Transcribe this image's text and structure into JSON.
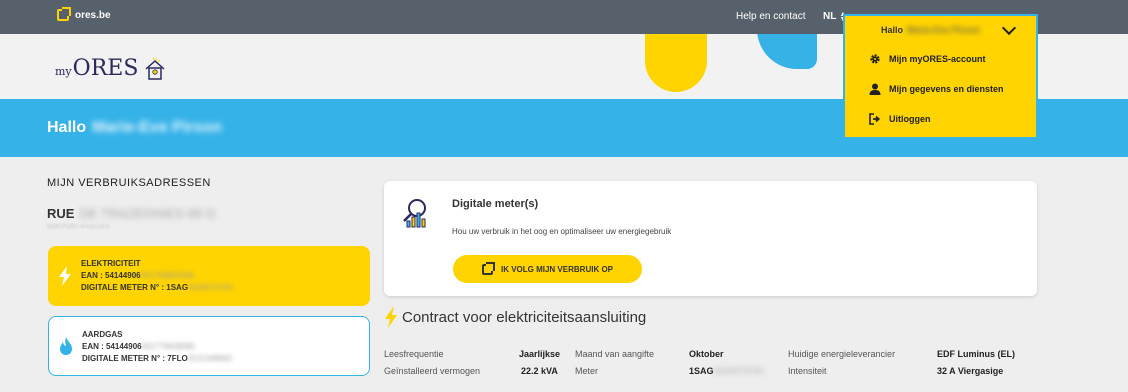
{
  "topbar": {
    "ores_link": "ores.be",
    "help": "Help en contact",
    "lang": "NL"
  },
  "account_menu": {
    "greeting": "Hallo",
    "user_name": "Marie-Eve Pirson",
    "items": [
      {
        "label": "Mijn myORES-account",
        "icon": "gear-icon"
      },
      {
        "label": "Mijn gegevens en diensten",
        "icon": "user-icon"
      },
      {
        "label": "Uitloggen",
        "icon": "logout-icon"
      }
    ]
  },
  "logo": {
    "my": "my",
    "ores": "ORES"
  },
  "hello_band": {
    "greeting": "Hallo",
    "user_name": "Marie-Eve Pirson"
  },
  "addresses": {
    "section_title": "MIJN VERBRUIKSADRESSEN",
    "street_prefix": "RUE",
    "street_hidden": "DE TRAZEGNIES 69 G",
    "city_hidden": "6230 PONT-A-CELLES",
    "meters": [
      {
        "type": "ELEKTRICITEIT",
        "ean_label": "EAN : 54144906",
        "ean_hidden": "001750820284",
        "meter_label": "DIGITALE METER N° : 1SAG",
        "meter_hidden": "3100074792",
        "icon": "bolt-icon"
      },
      {
        "type": "AARDGAS",
        "ean_label": "EAN : 54144906",
        "ean_hidden": "001779428365",
        "meter_label": "DIGITALE METER N° : 7FLO",
        "meter_hidden": "0121348942",
        "icon": "flame-icon"
      }
    ]
  },
  "digital_meter": {
    "title": "Digitale meter(s)",
    "description": "Hou uw verbruik in het oog en optimaliseer uw energiegebruik",
    "button": "IK VOLG MIJN VERBRUIK OP"
  },
  "contract": {
    "title": "Contract voor elektriciteitsaansluiting",
    "rows": [
      [
        {
          "label": "Leesfrequentie",
          "value": "Jaarlijkse"
        },
        {
          "label": "Maand van aangifte",
          "value": "Oktober"
        },
        {
          "label": "Huidige energieleverancier",
          "value": "EDF Luminus (EL)"
        }
      ],
      [
        {
          "label": "Geïnstalleerd vermogen",
          "value": "22.2 kVA"
        },
        {
          "label": "Meter",
          "value": "1SAG",
          "value_hidden": "3100074792"
        },
        {
          "label": "Intensiteit",
          "value": "32 A Viergasige"
        }
      ]
    ]
  },
  "colors": {
    "yellow": "#ffd400",
    "blue": "#35b2e8",
    "topbar": "#56616b"
  }
}
